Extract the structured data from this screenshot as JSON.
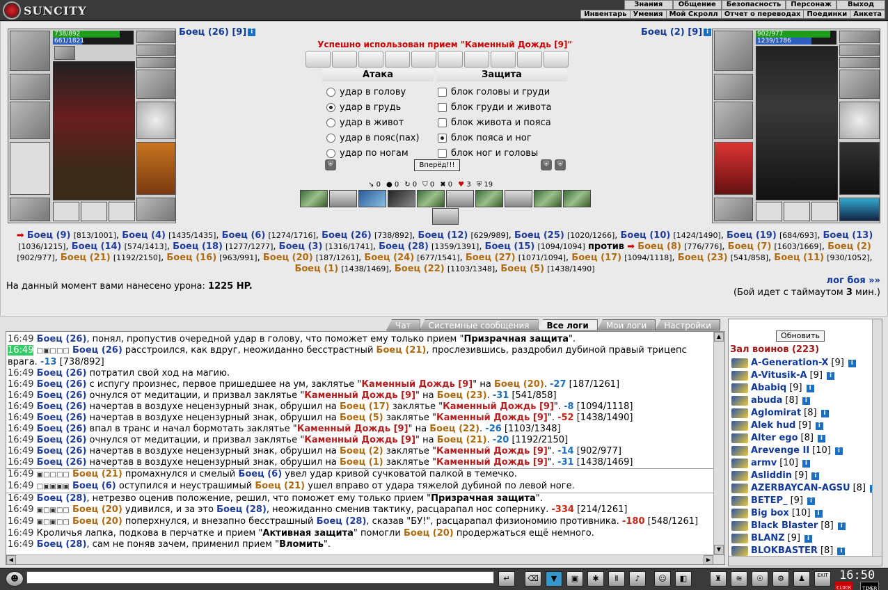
{
  "app": {
    "logo_text": "SUNCITY"
  },
  "topnav": [
    "Знания",
    "Общение",
    "Безопасность",
    "Персонаж",
    "Выход"
  ],
  "subnav": [
    "Инвентарь",
    "Умения",
    "Мой Скролл",
    "Отчет о переводах",
    "Поединки",
    "Анкета"
  ],
  "player_left": {
    "name": "Боец (26)",
    "level": "[9]",
    "hp": "738/892",
    "mp": "661/1821",
    "hp_frac": 0.83,
    "mp_frac": 0.36
  },
  "player_right": {
    "name": "Боец (2)",
    "level": "[9]",
    "hp": "902/977",
    "mp": "1239/1786",
    "hp_frac": 0.92,
    "mp_frac": 0.69
  },
  "battle_message": "Успешно использован прием \"Каменный Дождь [9]\"",
  "attack": {
    "header": "Атака",
    "options": [
      "удар в голову",
      "удар в грудь",
      "удар в живот",
      "удар в пояс(пах)",
      "удар по ногам"
    ],
    "selected": 1
  },
  "defense": {
    "header": "Защита",
    "options": [
      "блок головы и груди",
      "блок груди и живота",
      "блок живота и пояса",
      "блок пояса и ног",
      "блок ног и головы"
    ],
    "selected": 3
  },
  "go_button": "Вперёд!!!",
  "stats": [
    "0",
    "0",
    "0",
    "0",
    "0",
    "3",
    "19"
  ],
  "fighters_line": {
    "team_a": [
      {
        "n": "Боец (9)",
        "hp": "[813/1001]"
      },
      {
        "n": "Боец (4)",
        "hp": "[1435/1435]"
      },
      {
        "n": "Боец (6)",
        "hp": "[1274/1716]"
      },
      {
        "n": "Боец (26)",
        "hp": "[738/892]"
      },
      {
        "n": "Боец (12)",
        "hp": "[629/989]"
      },
      {
        "n": "Боец (25)",
        "hp": "[1020/1266]"
      },
      {
        "n": "Боец (10)",
        "hp": "[1424/1490]"
      },
      {
        "n": "Боец (19)",
        "hp": "[684/693]"
      },
      {
        "n": "Боец (13)",
        "hp": "[1036/1215]"
      },
      {
        "n": "Боец (14)",
        "hp": "[574/1413]"
      },
      {
        "n": "Боец (18)",
        "hp": "[1277/1277]"
      },
      {
        "n": "Боец (3)",
        "hp": "[1316/1741]"
      },
      {
        "n": "Боец (28)",
        "hp": "[1359/1391]"
      },
      {
        "n": "Боец (15)",
        "hp": "[1094/1094]"
      }
    ],
    "vs": "против",
    "team_b": [
      {
        "n": "Боец (8)",
        "hp": "[776/776]"
      },
      {
        "n": "Боец (7)",
        "hp": "[1603/1669]"
      },
      {
        "n": "Боец (2)",
        "hp": "[902/977]"
      },
      {
        "n": "Боец (21)",
        "hp": "[1192/2150]"
      },
      {
        "n": "Боец (16)",
        "hp": "[963/991]"
      },
      {
        "n": "Боец (20)",
        "hp": "[187/1261]"
      },
      {
        "n": "Боец (24)",
        "hp": "[677/1541]"
      },
      {
        "n": "Боец (27)",
        "hp": "[1071/1094]"
      },
      {
        "n": "Боец (17)",
        "hp": "[1094/1118]"
      },
      {
        "n": "Боец (23)",
        "hp": "[541/858]"
      },
      {
        "n": "Боец (11)",
        "hp": "[930/1052]"
      },
      {
        "n": "Боец (1)",
        "hp": "[1438/1469]"
      },
      {
        "n": "Боец (22)",
        "hp": "[1103/1348]"
      },
      {
        "n": "Боец (5)",
        "hp": "[1438/1490]"
      }
    ]
  },
  "damage_text": "На данный момент вами нанесено урона:",
  "damage_value": "1225 HP.",
  "log_link": "лог боя »»",
  "timeout_pre": "(Бой идет с таймаутом",
  "timeout_val": "3",
  "timeout_post": "мин.)",
  "tabs": [
    "Чат",
    "Системные сообщения",
    "Все логи",
    "Мои логи",
    "Настройки"
  ],
  "active_tab": 2,
  "log": [
    {
      "t": "16:49",
      "html": "<span class='bn'>Боец (26)</span>, понял, пропустив очередной удар в голову, что поможет ему только прием \"<b>Призрачная защита</b>\"."
    },
    {
      "t": "16:49",
      "hi": true,
      "icons": "□▣□□□",
      "html": "<span class='bn'>Боец (26)</span> расстроился, как вдруг, неожиданно бесстрастный <span class='on2'>Боец (21)</span>, прослезившись, раздробил дубиной правый трицепс"
    },
    {
      "t": "",
      "html": "врага. <span class='neg2'>-13</span> [738/892]"
    },
    {
      "t": "16:49",
      "html": "<span class='bn'>Боец (26)</span> потратил свой ход на магию."
    },
    {
      "t": "16:49",
      "html": "<span class='bn'>Боец (26)</span> с испугу произнес, первое пришедшее на ум, заклятье \"<span class='sp'>Каменный Дождь [9]</span>\" на <span class='on2'>Боец (20)</span>. <span class='neg2'>-27</span> [187/1261]"
    },
    {
      "t": "16:49",
      "html": "<span class='bn'>Боец (26)</span> очнулся от медитации, и призвал заклятье \"<span class='sp'>Каменный Дождь [9]</span>\" на <span class='on2'>Боец (23)</span>. <span class='neg2'>-31</span> [541/858]"
    },
    {
      "t": "16:49",
      "html": "<span class='bn'>Боец (26)</span> начертав в воздухе нецензурный знак, обрушил на <span class='on2'>Боец (17)</span> заклятье \"<span class='sp'>Каменный Дождь [9]</span>\". <span class='neg2'>-8</span> [1094/1118]"
    },
    {
      "t": "16:49",
      "html": "<span class='bn'>Боец (26)</span> начертав в воздухе нецензурный знак, обрушил на <span class='on2'>Боец (5)</span> заклятье \"<span class='sp'>Каменный Дождь [9]</span>\". <span class='neg'>-52</span> [1438/1490]"
    },
    {
      "t": "16:49",
      "html": "<span class='bn'>Боец (26)</span> впал в транс и начал бормотать заклятье \"<span class='sp'>Каменный Дождь [9]</span>\" на <span class='on2'>Боец (22)</span>. <span class='neg2'>-26</span> [1103/1348]"
    },
    {
      "t": "16:49",
      "html": "<span class='bn'>Боец (26)</span> очнулся от медитации, и призвал заклятье \"<span class='sp'>Каменный Дождь [9]</span>\" на <span class='on2'>Боец (21)</span>. <span class='neg2'>-20</span> [1192/2150]"
    },
    {
      "t": "16:49",
      "html": "<span class='bn'>Боец (26)</span> начертав в воздухе нецензурный знак, обрушил на <span class='on2'>Боец (2)</span> заклятье \"<span class='sp'>Каменный Дождь [9]</span>\". <span class='neg2'>-14</span> [902/977]"
    },
    {
      "t": "16:49",
      "html": "<span class='bn'>Боец (26)</span> начертав в воздухе нецензурный знак, обрушил на <span class='on2'>Боец (1)</span> заклятье \"<span class='sp'>Каменный Дождь [9]</span>\". <span class='neg2'>-31</span> [1438/1469]"
    },
    {
      "t": "16:49",
      "sep": true,
      "icons": "▣□□□□",
      "html": "<span class='on2'>Боец (21)</span> промахнулся и смелый <span class='bn'>Боец (6)</span> увел удар кривой сучковатой палкой в темечко."
    },
    {
      "t": "16:49",
      "icons": "□▣▣▣▣",
      "html": "<span class='bn'>Боец (6)</span> оступился и неустрашимый <span class='on2'>Боец (21)</span> ушел вправо от удара тяжелой дубиной по левой ноге."
    },
    {
      "t": "16:49",
      "sep": true,
      "html": "<span class='bn'>Боец (28)</span>, нетрезво оценив положение, решил, что поможет ему только прием \"<b>Призрачная защита</b>\"."
    },
    {
      "t": "16:49",
      "icons": "▣□▣□□",
      "html": "<span class='on2'>Боец (20)</span> удивился, и за это <span class='bn'>Боец (28)</span>, неожиданно сменив тактику, расцарапал нос сопернику. <span class='neg'>-334</span> [214/1261]"
    },
    {
      "t": "16:49",
      "icons": "▣□▣□□",
      "html": "<span class='on2'>Боец (20)</span> поперхнулся, и внезапно бесстрашный <span class='bn'>Боец (28)</span>, сказав \"БУ!\", расцарапал физиономию противника. <span class='neg'>-180</span> [548/1261]"
    },
    {
      "t": "16:49",
      "html": "Кроличья лапка, подкова в перчатке и прием \"<b>Активная защита</b>\" помогли <span class='on2'>Боец (20)</span> продержаться ещё немного."
    },
    {
      "t": "16:49",
      "html": "<span class='bn'>Боец (28)</span>, сам не поняв зачем, применил прием \"<b>Вломить</b>\"."
    }
  ],
  "right_panel": {
    "refresh": "Обновить",
    "hall": "Зал воинов (223)",
    "users": [
      {
        "n": "A-Generation-X",
        "l": "[9]"
      },
      {
        "n": "A-Vitusik-A",
        "l": "[9]"
      },
      {
        "n": "Ababiq",
        "l": "[9]"
      },
      {
        "n": "abuda",
        "l": "[8]"
      },
      {
        "n": "Aglomirat",
        "l": "[8]"
      },
      {
        "n": "Alek hud",
        "l": "[9]"
      },
      {
        "n": "Alter ego",
        "l": "[8]"
      },
      {
        "n": "Arevenge II",
        "l": "[10]"
      },
      {
        "n": "armv",
        "l": "[10]"
      },
      {
        "n": "Asliddin",
        "l": "[9]"
      },
      {
        "n": "AZERBAYCAN-AGSU",
        "l": "[8]"
      },
      {
        "n": "BETEP_",
        "l": "[9]"
      },
      {
        "n": "Big box",
        "l": "[10]"
      },
      {
        "n": "Black Blaster",
        "l": "[8]"
      },
      {
        "n": "BLANZ",
        "l": "[9]"
      },
      {
        "n": "BLOKBASTER",
        "l": "[8]"
      }
    ]
  },
  "clock": {
    "time": "16:50",
    "clock_label": "CLOCK",
    "timer_label": "TIMER",
    "exit": "EXIT"
  }
}
